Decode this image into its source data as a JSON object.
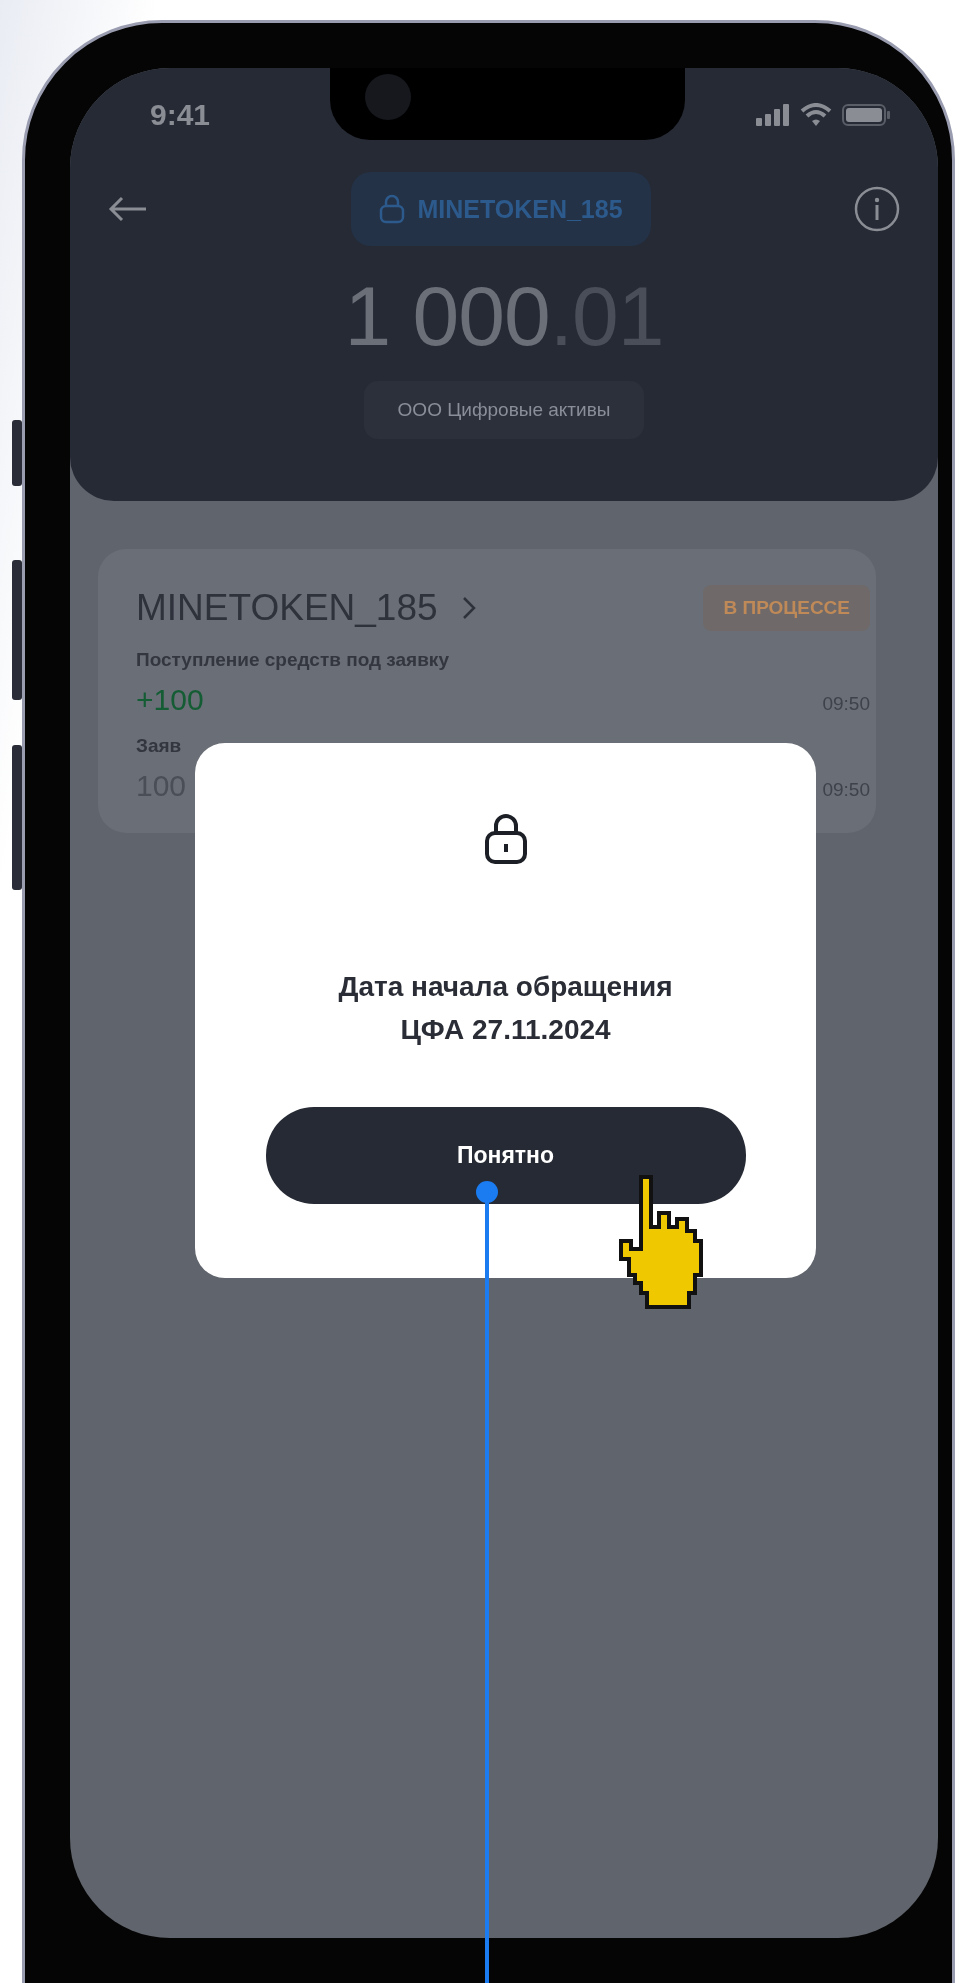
{
  "status_bar": {
    "time": "9:41"
  },
  "header": {
    "token_chip": "MINETOKEN_185",
    "balance": {
      "integer": "1 000",
      "fraction": ".01"
    },
    "issuer": "ООО Цифровые активы"
  },
  "card": {
    "title": "MINETOKEN_185",
    "status": "В ПРОЦЕССЕ",
    "rows": [
      {
        "kind": "income",
        "label": "Поступление средств под заявку",
        "amount": "+100",
        "time": "09:50"
      },
      {
        "kind": "order",
        "label": "Заяв",
        "amount": "100",
        "time": "09:50"
      }
    ]
  },
  "modal": {
    "message": "Дата начала обращения ЦФА 27.11.2024",
    "button": "Понятно"
  }
}
